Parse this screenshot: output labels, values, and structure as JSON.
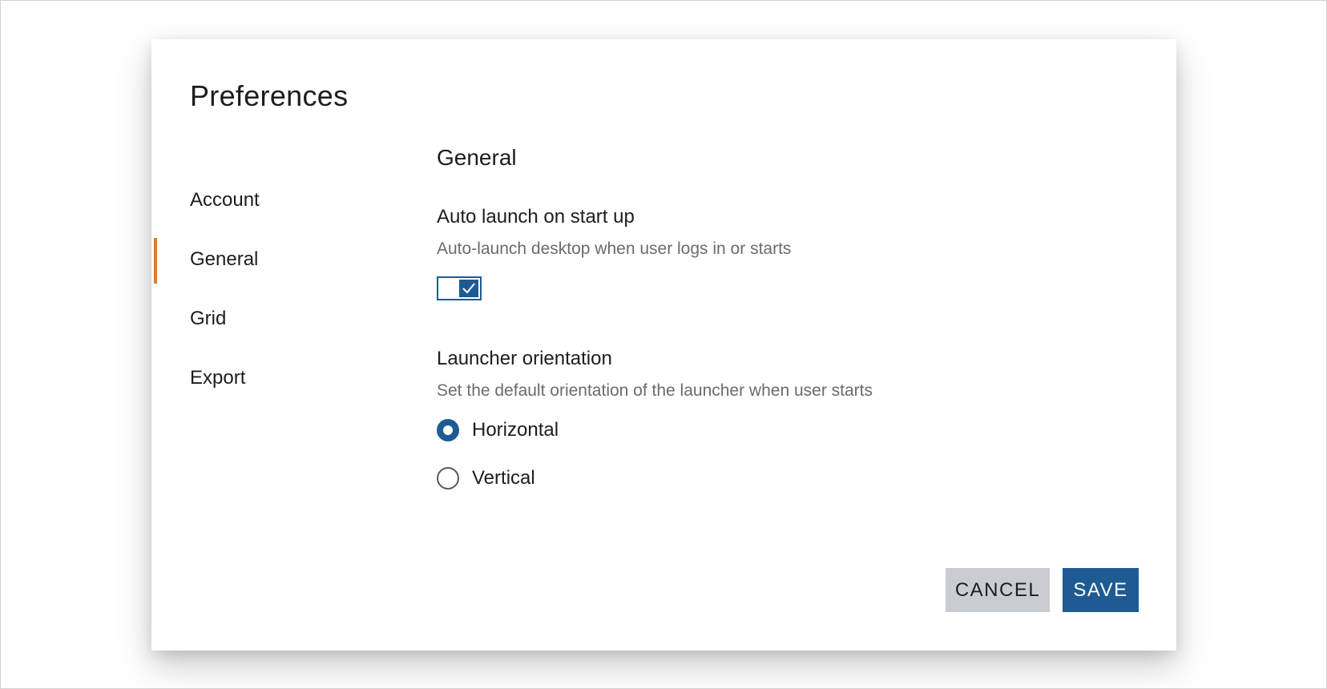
{
  "dialog": {
    "title": "Preferences"
  },
  "nav": {
    "items": [
      {
        "label": "Account",
        "active": false
      },
      {
        "label": "General",
        "active": true
      },
      {
        "label": "Grid",
        "active": false
      },
      {
        "label": "Export",
        "active": false
      }
    ]
  },
  "general": {
    "section_title": "General",
    "auto_launch": {
      "label": "Auto launch on start up",
      "description": "Auto-launch desktop when user logs in or starts",
      "enabled": true
    },
    "orientation": {
      "label": "Launcher orientation",
      "description": "Set the default orientation of the launcher when user starts",
      "options": [
        {
          "label": "Horizontal",
          "selected": true
        },
        {
          "label": "Vertical",
          "selected": false
        }
      ]
    }
  },
  "actions": {
    "cancel_label": "CANCEL",
    "save_label": "SAVE"
  },
  "colors": {
    "accent": "#1e5b93",
    "active_indicator": "#e07a2e",
    "cancel_bg": "#c9cdd2",
    "description_text": "#6b6b70"
  }
}
